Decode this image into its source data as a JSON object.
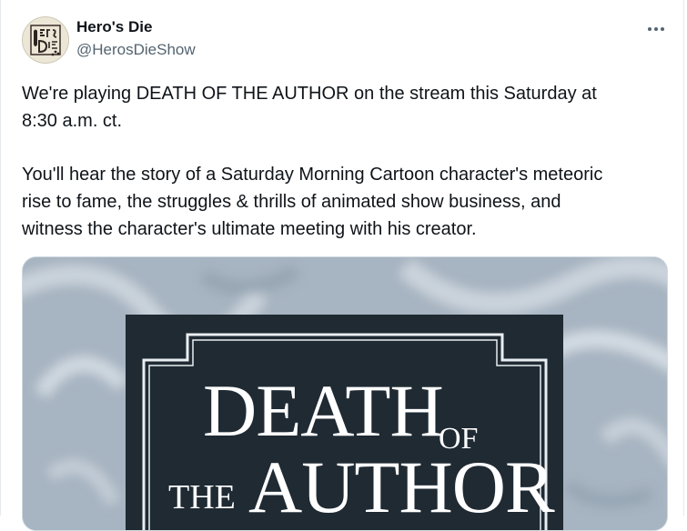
{
  "author": {
    "display_name": "Hero's Die",
    "handle": "@HerosDieShow",
    "avatar_icon": "dice-logo-icon"
  },
  "menu": {
    "icon": "more-options-icon"
  },
  "tweet": {
    "paragraphs": [
      "We're playing DEATH OF THE AUTHOR on the stream this Saturday at\n8:30 a.m. ct.",
      "You'll hear the story of a Saturday Morning Cartoon character's meteoric\nrise to fame, the struggles & thrills of animated show business, and\nwitness the character's ultimate meeting with his creator."
    ]
  },
  "media": {
    "title_words": [
      "DEATH",
      "OF",
      "THE",
      "AUTHOR"
    ],
    "colors": {
      "background": "#a9b6c3",
      "panel": "#1f2a33",
      "text": "#ffffff",
      "border": "#e9eef2"
    }
  }
}
